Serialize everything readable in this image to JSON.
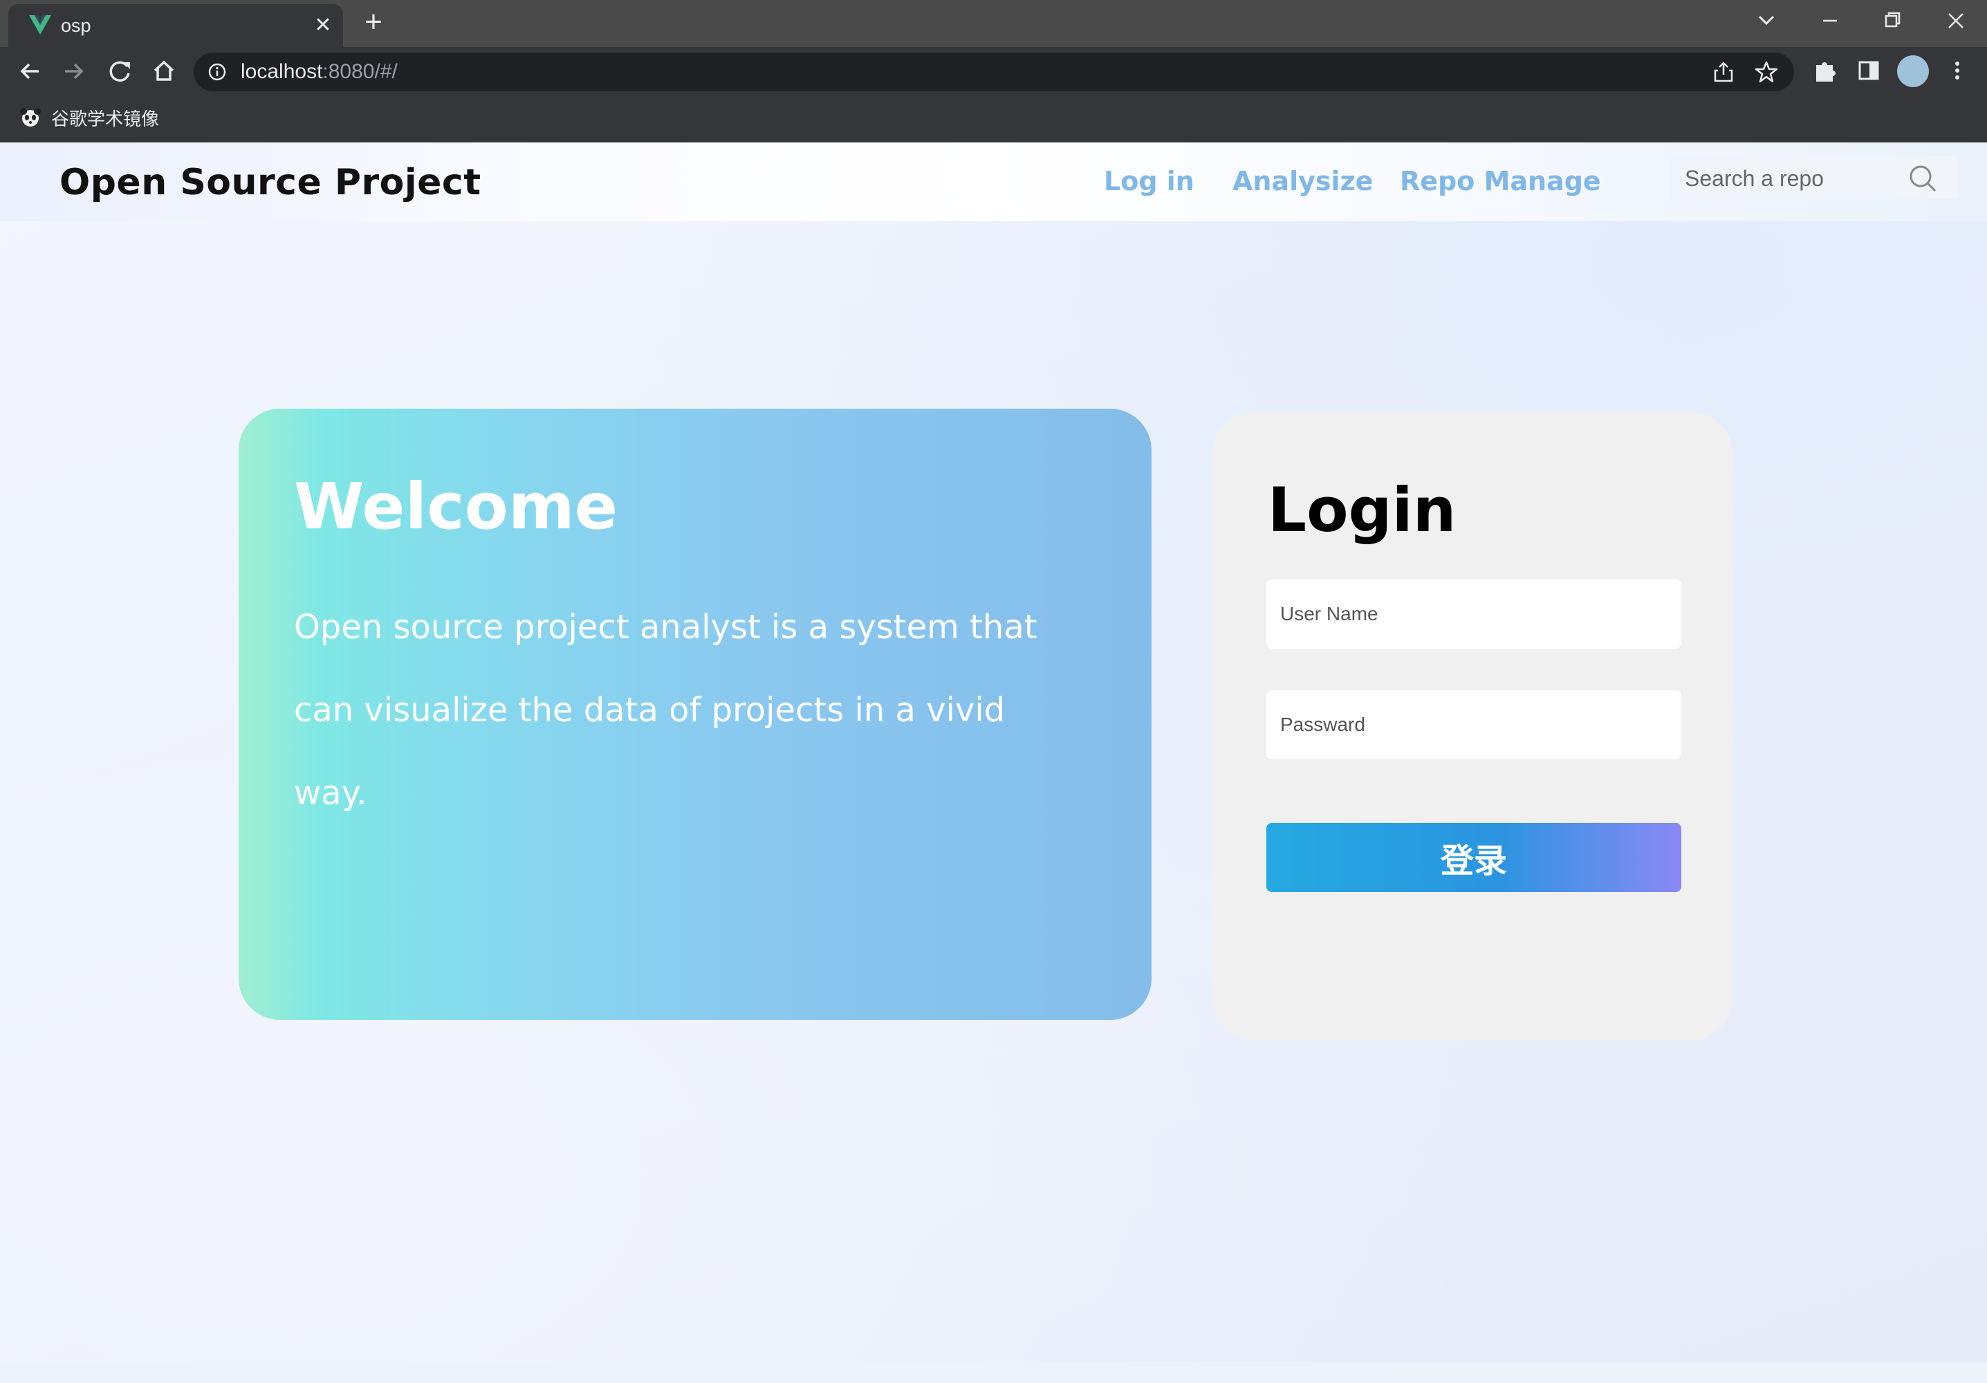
{
  "browser": {
    "tab_title": "osp",
    "url_host": "localhost",
    "url_rest": ":8080/#/",
    "bookmark_label": "谷歌学术镜像",
    "favicon_color": "#41b883"
  },
  "header": {
    "brand": "Open Source Project",
    "nav": {
      "login": "Log in",
      "analysize": "Analysize",
      "repo_manage": "Repo Manage"
    },
    "search_placeholder": "Search a repo"
  },
  "welcome": {
    "title": "Welcome",
    "description": "Open source project analyst is a system that can visualize the data of projects in a vivid way."
  },
  "login": {
    "title": "Login",
    "username_placeholder": "User Name",
    "password_placeholder": "Passward",
    "submit_label": "登录"
  },
  "colors": {
    "nav_link": "#7fb8e8",
    "login_button_start": "#25a9e1",
    "login_button_end": "#8a88f4"
  }
}
